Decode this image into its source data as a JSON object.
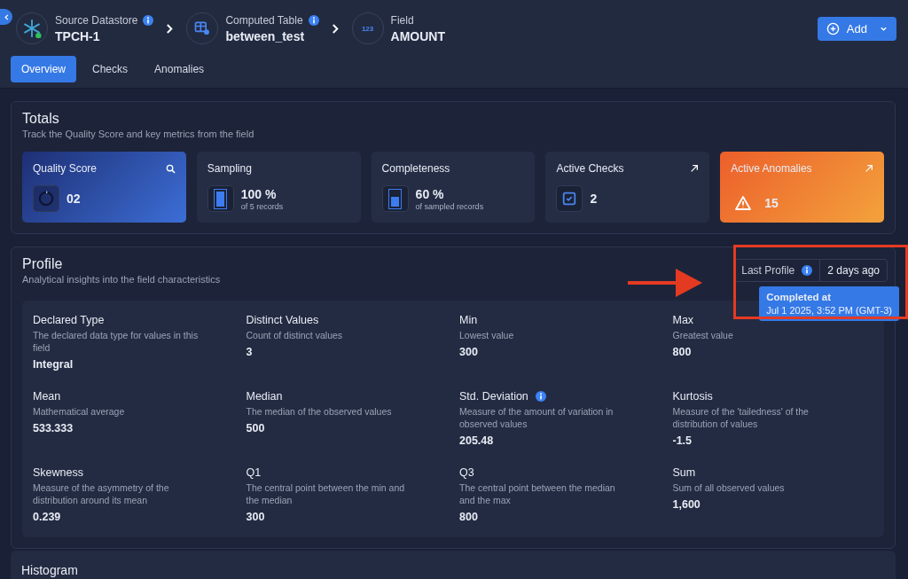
{
  "breadcrumbs": [
    {
      "kind": "datastore",
      "label": "Source Datastore",
      "value": "TPCH-1",
      "info": true
    },
    {
      "kind": "table",
      "label": "Computed Table",
      "value": "between_test",
      "info": true
    },
    {
      "kind": "field",
      "label": "Field",
      "value": "AMOUNT",
      "info": false,
      "icon_text": "123"
    }
  ],
  "add_button": {
    "label": "Add"
  },
  "tabs": [
    {
      "label": "Overview",
      "selected": true
    },
    {
      "label": "Checks",
      "selected": false
    },
    {
      "label": "Anomalies",
      "selected": false
    }
  ],
  "totals": {
    "title": "Totals",
    "subtitle": "Track the Quality Score and key metrics from the field",
    "cards": [
      {
        "kind": "score",
        "label": "Quality Score",
        "value": "02"
      },
      {
        "kind": "sampling",
        "label": "Sampling",
        "value": "100 %",
        "caption": "of 5 records",
        "level": 1
      },
      {
        "kind": "completeness",
        "label": "Completeness",
        "value": "60 %",
        "caption": "of sampled records",
        "level": 0.6
      },
      {
        "kind": "checks",
        "label": "Active Checks",
        "value": "2"
      },
      {
        "kind": "anomalies",
        "label": "Active Anomalies",
        "value": "15"
      }
    ]
  },
  "profile": {
    "title": "Profile",
    "subtitle": "Analytical insights into the field characteristics",
    "last_profile": {
      "label": "Last Profile",
      "value": "2 days ago"
    },
    "tooltip": {
      "title": "Completed at",
      "text": "Jul 1 2025, 3:52 PM (GMT-3)"
    },
    "stats": [
      {
        "label": "Declared Type",
        "description": "The declared data type for values in this field",
        "value": "Integral",
        "info": false
      },
      {
        "label": "Distinct Values",
        "description": "Count of distinct values",
        "value": "3",
        "info": false
      },
      {
        "label": "Min",
        "description": "Lowest value",
        "value": "300",
        "info": false
      },
      {
        "label": "Max",
        "description": "Greatest value",
        "value": "800",
        "info": false
      },
      {
        "label": "Mean",
        "description": "Mathematical average",
        "value": "533.333",
        "info": false
      },
      {
        "label": "Median",
        "description": "The median of the observed values",
        "value": "500",
        "info": false
      },
      {
        "label": "Std. Deviation",
        "description": "Measure of the amount of variation in observed values",
        "value": "205.48",
        "info": true
      },
      {
        "label": "Kurtosis",
        "description": "Measure of the 'tailedness' of the distribution of values",
        "value": "-1.5",
        "info": false
      },
      {
        "label": "Skewness",
        "description": "Measure of the asymmetry of the distribution around its mean",
        "value": "0.239",
        "info": false
      },
      {
        "label": "Q1",
        "description": "The central point between the min and the median",
        "value": "300",
        "info": false
      },
      {
        "label": "Q3",
        "description": "The central point between the median and the max",
        "value": "800",
        "info": false
      },
      {
        "label": "Sum",
        "description": "Sum of all observed values",
        "value": "1,600",
        "info": false
      }
    ]
  },
  "histogram": {
    "title": "Histogram"
  }
}
